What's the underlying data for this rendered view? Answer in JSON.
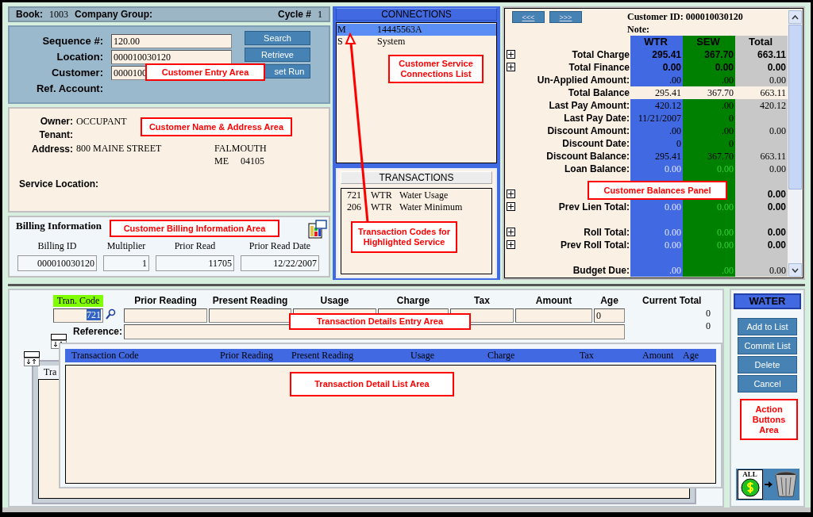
{
  "header": {
    "book_label": "Book:",
    "book": "1003",
    "company_group_label": "Company Group:",
    "cycle_label": "Cycle #",
    "cycle": "1"
  },
  "customer_entry": {
    "fields": [
      {
        "label": "Sequence #:",
        "value": "120.00"
      },
      {
        "label": "Location:",
        "value": "000010030120"
      },
      {
        "label": "Customer:",
        "value": "0000100"
      },
      {
        "label": "Ref. Account:"
      }
    ],
    "buttons": [
      "Search",
      "Retrieve",
      "set Run"
    ]
  },
  "name_address": {
    "owner_label": "Owner:",
    "owner": "OCCUPANT",
    "tenant_label": "Tenant:",
    "address_label": "Address:",
    "address": "800 MAINE STREET",
    "city": "FALMOUTH",
    "state": "ME",
    "zip": "04105",
    "service_location_label": "Service Location:"
  },
  "billing": {
    "title": "Billing Information",
    "columns": [
      {
        "label": "Billing ID",
        "value": "000010030120"
      },
      {
        "label": "Multiplier",
        "value": "1"
      },
      {
        "label": "Prior Read",
        "value": "11705"
      },
      {
        "label": "Prior Read Date",
        "value": "12/22/2007"
      }
    ]
  },
  "connections": {
    "title": "CONNECTIONS",
    "items": [
      {
        "code": "M",
        "name": "14445563A",
        "selected": true
      },
      {
        "code": "S",
        "name": "System",
        "selected": false
      }
    ]
  },
  "transactions": {
    "title": "TRANSACTIONS",
    "items": [
      {
        "code": "721",
        "service": "WTR",
        "description": "Water Usage"
      },
      {
        "code": "206",
        "service": "WTR",
        "description": "Water Minimum"
      }
    ]
  },
  "balances": {
    "prev_button": "<<<",
    "next_button": ">>>",
    "customer_id_label": "Customer ID:",
    "customer_id": "000010030120",
    "note_label": "Note:",
    "columns": [
      "WTR",
      "SEW",
      "Total"
    ],
    "rows": [
      {
        "label": "Total Charge",
        "kind": "bold",
        "expandable": true,
        "wtr": "295.41",
        "sew": "367.70",
        "total": "663.11"
      },
      {
        "label": "Total Finance",
        "kind": "bold",
        "expandable": true,
        "wtr": "0.00",
        "sew": "0.00",
        "total": "0.00"
      },
      {
        "label": "Un-Applied Amount:",
        "kind": "plain",
        "expandable": false,
        "wtr": ".00",
        "sew": ".00",
        "total": "0.00"
      },
      {
        "label": "Total Balance",
        "kind": "highlight",
        "expandable": false,
        "wtr": "295.41",
        "sew": "367.70",
        "total": "663.11"
      },
      {
        "label": "Last Pay Amount:",
        "kind": "plain",
        "expandable": false,
        "wtr": "420.12",
        "sew": ".00",
        "total": "420.12"
      },
      {
        "label": "Last Pay Date:",
        "kind": "plain",
        "expandable": false,
        "wtr": "11/21/2007",
        "sew": "0"
      },
      {
        "label": "Discount Amount:",
        "kind": "plain",
        "expandable": false,
        "wtr": ".00",
        "sew": ".00",
        "total": "0.00"
      },
      {
        "label": "Discount Date:",
        "kind": "plain",
        "expandable": false,
        "wtr": "0",
        "sew": "0"
      },
      {
        "label": "Discount Balance:",
        "kind": "plain",
        "expandable": false,
        "wtr": "295.41",
        "sew": "367.70",
        "total": "663.11"
      },
      {
        "label": "Loan Balance:",
        "kind": "faded",
        "expandable": false,
        "wtr": "0.00",
        "sew": "0.00",
        "total": "0.00"
      },
      {
        "kind": "spacer",
        "expandable": false
      },
      {
        "kind": "faded_sum",
        "expandable": true,
        "total": "0.00"
      },
      {
        "label": "Prev Lien Total:",
        "kind": "faded_sum",
        "expandable": true,
        "wtr": "0.00",
        "sew": "0.00",
        "total": "0.00"
      },
      {
        "kind": "spacer",
        "expandable": false
      },
      {
        "label": "Roll Total:",
        "kind": "faded_sum",
        "expandable": true,
        "wtr": "0.00",
        "sew": "0.00",
        "total": "0.00"
      },
      {
        "label": "Prev Roll Total:",
        "kind": "faded_sum",
        "expandable": true,
        "wtr": "0.00",
        "sew": "0.00",
        "total": "0.00"
      },
      {
        "kind": "spacer",
        "expandable": false
      },
      {
        "label": "Budget Due:",
        "kind": "faded",
        "expandable": false,
        "wtr": ".00",
        "sew": ".00",
        "total": "0.00"
      }
    ]
  },
  "entry": {
    "tran_code_label": "Tran. Code",
    "tran_code": "721",
    "columns": [
      "Prior Reading",
      "Present Reading",
      "Usage",
      "Charge",
      "Tax",
      "Amount",
      "Age"
    ],
    "age_value": "0",
    "reference_label": "Reference:",
    "current_total_label": "Current Total",
    "current_totals": [
      "0",
      "0"
    ]
  },
  "detail_list": {
    "columns": [
      "Transaction Code",
      "Prior Reading",
      "Present Reading",
      "Usage",
      "Charge",
      "Tax",
      "Amount",
      "Age"
    ],
    "back_heading": "Tra"
  },
  "actions": {
    "title": "WATER",
    "buttons": [
      "Add to List",
      "Commit List",
      "Delete",
      "Cancel"
    ],
    "write_off_label": "ALL"
  },
  "annotations": [
    "Customer Entry Area",
    "Customer Name & Address Area",
    "Customer Billing Information Area",
    "Customer Service Connections List",
    "Transaction Codes for Highlighted Service",
    "Customer Balances Panel",
    "Transaction Details Entry Area",
    "Transaction Detail List Area",
    "Action Buttons Area"
  ]
}
